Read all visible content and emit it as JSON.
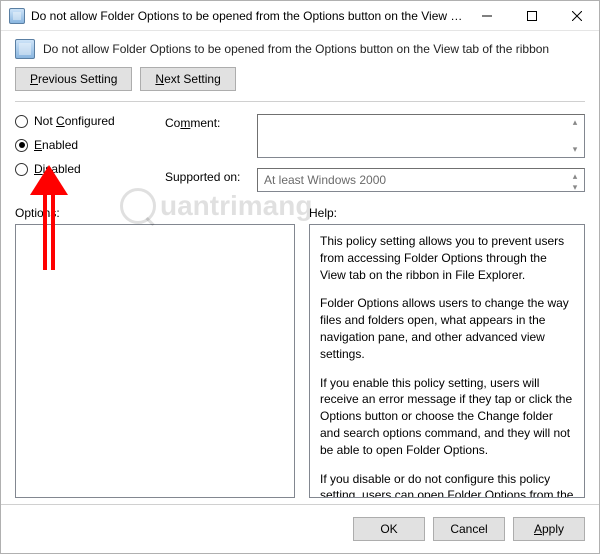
{
  "title": "Do not allow Folder Options to be opened from the Options button on the View tab of the ribbon",
  "header_title": "Do not allow Folder Options to be opened from the Options button on the View tab of the ribbon",
  "nav": {
    "prev_pre": "",
    "prev_m": "P",
    "prev_post": "revious Setting",
    "next_pre": "",
    "next_m": "N",
    "next_post": "ext Setting"
  },
  "radios": {
    "not_configured_pre": "Not ",
    "not_configured_m": "C",
    "not_configured_post": "onfigured",
    "enabled_m": "E",
    "enabled_post": "nabled",
    "disabled_m": "D",
    "disabled_post": "isabled",
    "selected": "enabled"
  },
  "labels": {
    "comment_pre": "Co",
    "comment_m": "m",
    "comment_post": "ment:",
    "supported": "Supported on:",
    "options": "Options:",
    "help": "Help:"
  },
  "comment_value": "",
  "supported_value": "At least Windows 2000",
  "help": {
    "p1": "This policy setting allows you to prevent users from accessing Folder Options through the View tab on the ribbon in File Explorer.",
    "p2": "Folder Options allows users to change the way files and folders open, what appears in the navigation pane, and other advanced view settings.",
    "p3": "If you enable this policy setting, users will receive an error message if they tap or click the Options button or choose the Change folder and search options command, and they will not be able to open Folder Options.",
    "p4": "If you disable or do not configure this policy setting, users can open Folder Options from the View tab on the ribbon."
  },
  "buttons": {
    "ok": "OK",
    "cancel": "Cancel",
    "apply_m": "A",
    "apply_post": "pply"
  },
  "watermark": "uantrimang"
}
